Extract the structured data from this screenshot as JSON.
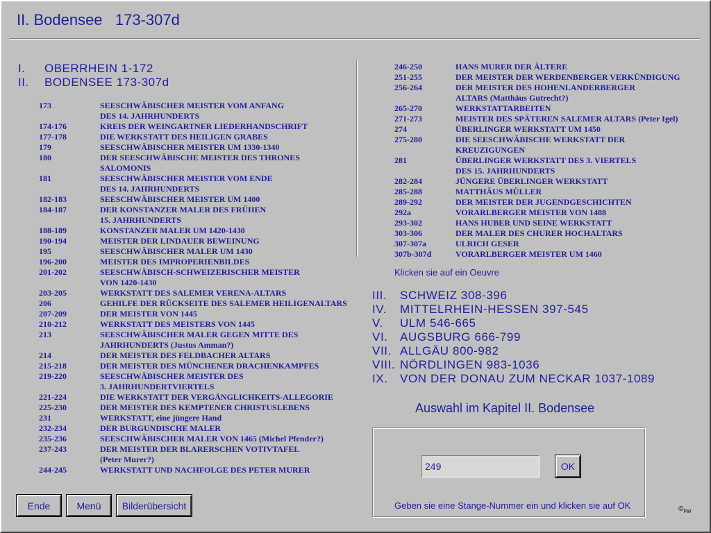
{
  "title": "II. Bodensee   173-307d",
  "chapters_top": [
    {
      "roman": "I.",
      "label": "OBERRHEIN 1-172"
    },
    {
      "roman": "II.",
      "label": "BODENSEE 173-307d"
    }
  ],
  "entries_left": [
    {
      "num": "173",
      "text": "SEESCHWÄBISCHER MEISTER VOM ANFANG"
    },
    {
      "num": "",
      "text": "DES 14. JAHRHUNDERTS"
    },
    {
      "num": "174-176",
      "text": "KREIS DER WEINGARTNER LIEDERHANDSCHRIFT"
    },
    {
      "num": "177-178",
      "text": "DIE WERKSTATT DES HEILIGEN GRABES"
    },
    {
      "num": "179",
      "text": "SEESCHWÄBISCHER MEISTER UM 1330-1340"
    },
    {
      "num": "180",
      "text": "DER SEESCHWÄBISCHE MEISTER DES THRONES"
    },
    {
      "num": "",
      "text": "SALOMONIS"
    },
    {
      "num": "181",
      "text": "SEESCHWÄBISCHER MEISTER VOM ENDE"
    },
    {
      "num": "",
      "text": "DES 14. JAHRHUNDERTS"
    },
    {
      "num": "182-183",
      "text": "SEESCHWÄBISCHER MEISTER UM 1400"
    },
    {
      "num": "184-187",
      "text": "DER KONSTANZER MALER DES FRÜHEN"
    },
    {
      "num": "",
      "text": "15. JAHRHUNDERTS"
    },
    {
      "num": "188-189",
      "text": "KONSTANZER MALER UM 1420-1430"
    },
    {
      "num": "190-194",
      "text": "MEISTER DER LINDAUER BEWEINUNG"
    },
    {
      "num": "195",
      "text": "SEESCHWÄBISCHER MALER UM 1430"
    },
    {
      "num": "196-200",
      "text": "MEISTER DES IMPROPERIENBILDES"
    },
    {
      "num": "201-202",
      "text": "SEESCHWÄBISCH-SCHWEIZERISCHER MEISTER"
    },
    {
      "num": "",
      "text": "VON 1420-1430"
    },
    {
      "num": "203-205",
      "text": "WERKSTATT DES SALEMER VERENA-ALTARS"
    },
    {
      "num": "206",
      "text": "GEHILFE DER RÜCKSEITE DES SALEMER HEILIGENALTARS"
    },
    {
      "num": "207-209",
      "text": "DER MEISTER VON 1445"
    },
    {
      "num": "210-212",
      "text": "WERKSTATT DES MEISTERS VON 1445"
    },
    {
      "num": "213",
      "text": "SEESCHWÄBISCHER MALER GEGEN MITTE DES"
    },
    {
      "num": "",
      "text": "JAHRHUNDERTS (Justus Amman?)"
    },
    {
      "num": "214",
      "text": "DER MEISTER DES FELDBACHER ALTARS"
    },
    {
      "num": "215-218",
      "text": "DER MEISTER DES MÜNCHENER DRACHENKAMPFES"
    },
    {
      "num": "219-220",
      "text": "SEESCHWÄBISCHER MEISTER DES"
    },
    {
      "num": "",
      "text": "3. JAHRHUNDERTVIERTELS"
    },
    {
      "num": "221-224",
      "text": "DIE WERKSTATT DER VERGÄNGLICHKEITS-ALLEGORIE"
    },
    {
      "num": "225-230",
      "text": "DER MEISTER DES KEMPTENER CHRISTUSLEBENS"
    },
    {
      "num": "231",
      "text": "WERKSTATT, eine jüngere Hand"
    },
    {
      "num": "232-234",
      "text": "DER BURGUNDISCHE MALER"
    },
    {
      "num": "235-236",
      "text": "SEESCHWÄBISCHER MALER VON 1465 (Michel Pfender?)"
    },
    {
      "num": "237-243",
      "text": "DER MEISTER DER BLARERSCHEN VOTIVTAFEL"
    },
    {
      "num": "",
      "text": "(Peter Murer?)"
    },
    {
      "num": "244-245",
      "text": "WERKSTATT UND NACHFOLGE DES PETER MURER"
    }
  ],
  "entries_right": [
    {
      "num": "246-250",
      "text": "HANS MURER DER ÄLTERE"
    },
    {
      "num": "251-255",
      "text": "DER MEISTER DER WERDENBERGER VERKÜNDIGUNG"
    },
    {
      "num": "256-264",
      "text": "DER MEISTER DES HOHENLANDERBERGER"
    },
    {
      "num": "",
      "text": "ALTARS (Matthäus Gutrecht?)"
    },
    {
      "num": "265-270",
      "text": "WERKSTATTARBEITEN"
    },
    {
      "num": "271-273",
      "text": "MEISTER DES SPÄTEREN SALEMER ALTARS (Peter Igel)"
    },
    {
      "num": "274",
      "text": "ÜBERLINGER WERKSTATT UM 1450"
    },
    {
      "num": "275-280",
      "text": "DIE SEESCHWÄBISCHE WERKSTATT DER"
    },
    {
      "num": "",
      "text": "KREUZIGUNGEN"
    },
    {
      "num": "281",
      "text": "ÜBERLINGER WERKSTATT DES 3. VIERTELS"
    },
    {
      "num": "",
      "text": "DES 15. JAHRHUNDERTS"
    },
    {
      "num": "282-284",
      "text": "JÜNGERE ÜBERLINGER WERKSTATT"
    },
    {
      "num": "285-288",
      "text": "MATTHÄUS MÜLLER"
    },
    {
      "num": "289-292",
      "text": "DER MEISTER DER JUGENDGESCHICHTEN"
    },
    {
      "num": "292a",
      "text": "VORARLBERGER MEISTER VON 1488"
    },
    {
      "num": "293-302",
      "text": "HANS HUBER UND SEINE WERKSTATT"
    },
    {
      "num": "303-306",
      "text": "DER MALER DES CHURER HOCHALTARS"
    },
    {
      "num": "307-307a",
      "text": "ULRICH GESER"
    },
    {
      "num": "307b-307d",
      "text": "VORARLBERGER MEISTER UM 1460"
    }
  ],
  "hint_click": "Klicken sie auf ein Oeuvre",
  "chapters_other": [
    {
      "roman": "III.",
      "label": "SCHWEIZ 308-396"
    },
    {
      "roman": "IV.",
      "label": "MITTELRHEIN-HESSEN 397-545"
    },
    {
      "roman": "V.",
      "label": "ULM 546-665"
    },
    {
      "roman": "VI.",
      "label": "AUGSBURG 666-799"
    },
    {
      "roman": "VII.",
      "label": "ALLGÄU 800-982"
    },
    {
      "roman": "VIII.",
      "label": "NÖRDLINGEN 983-1036"
    },
    {
      "roman": "IX.",
      "label": "VON DER DONAU ZUM NECKAR 1037-1089"
    }
  ],
  "auswahl": "Auswahl im Kapitel II. Bodensee",
  "number_input": {
    "value": "249"
  },
  "ok_label": "OK",
  "input_hint": "Geben sie eine Stange-Nummer ein und klicken sie auf OK",
  "buttons": {
    "ende": "Ende",
    "menu": "Menü",
    "bilder": "Bilderübersicht"
  },
  "copyright": "©",
  "copyright_sub": "PW"
}
